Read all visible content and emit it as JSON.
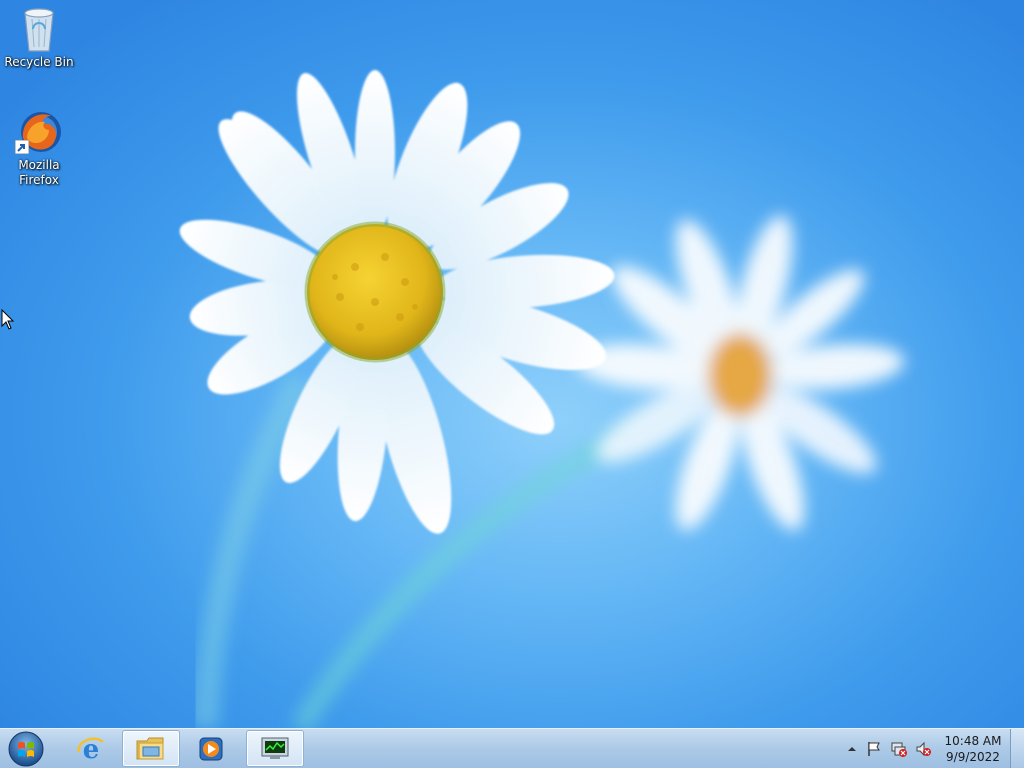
{
  "desktop": {
    "icons": [
      {
        "label": "Recycle Bin",
        "icon": "recycle-bin-icon"
      },
      {
        "label": "Mozilla Firefox",
        "icon": "firefox-icon"
      }
    ]
  },
  "taskbar": {
    "start_icon": "windows-start-orb-icon",
    "pinned": [
      {
        "name": "Internet Explorer",
        "icon": "internet-explorer-icon"
      },
      {
        "name": "Windows Explorer",
        "icon": "folder-explorer-icon"
      },
      {
        "name": "Windows Media Player",
        "icon": "media-player-icon"
      },
      {
        "name": "Task Manager",
        "icon": "task-manager-icon"
      }
    ],
    "tray_icons": [
      "show-hidden-icons-arrow",
      "action-center-flag-icon",
      "network-disconnected-icon",
      "volume-muted-icon"
    ],
    "clock": {
      "time": "10:48 AM",
      "date": "9/9/2022"
    }
  },
  "colors": {
    "wallpaper_blue": "#3d98ea",
    "taskbar": "#aecbe8"
  }
}
